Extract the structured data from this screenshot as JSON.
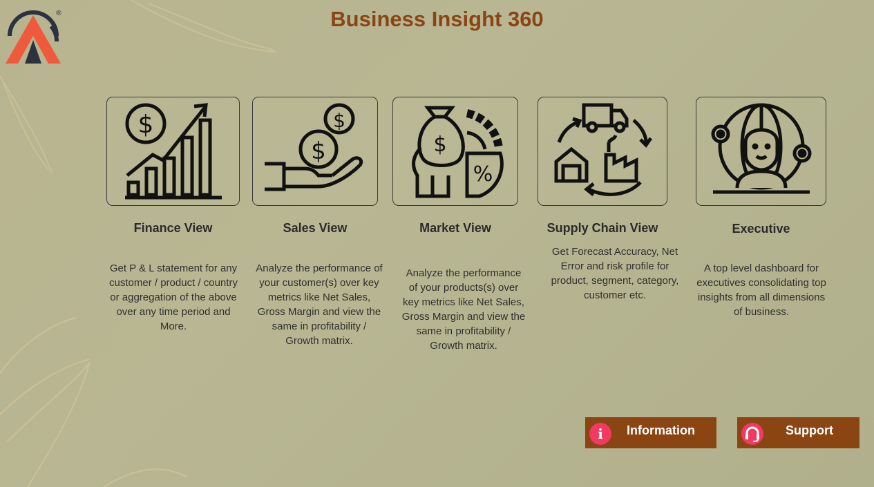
{
  "header": {
    "title": "Business Insight 360"
  },
  "logo": {
    "icon": "atliq-logo-icon",
    "mark": "®"
  },
  "cards": [
    {
      "heading": "Finance View",
      "icon": "finance-growth-icon",
      "description": "Get  P & L statement for any customer / product / country or aggregation of the above over any time period and More."
    },
    {
      "heading": "Sales View",
      "icon": "hand-coins-icon",
      "description": "Analyze the performance of your customer(s) over key metrics like Net Sales, Gross Margin and view the same in profitability / Growth matrix."
    },
    {
      "heading": "Market View",
      "icon": "market-money-bag-icon",
      "description": "Analyze the performance of your products(s) over key metrics like Net Sales, Gross Margin and view the same in profitability / Growth matrix."
    },
    {
      "heading": "Supply Chain View",
      "icon": "supply-chain-truck-icon",
      "description": "Get Forecast Accuracy, Net Error and risk profile for product, segment, category, customer etc."
    },
    {
      "heading": "Executive",
      "icon": "executive-globe-icon",
      "description": "A top level dashboard for executives consolidating top insights from all dimensions of business."
    }
  ],
  "buttons": {
    "information": {
      "label": "Information",
      "icon": "info-icon"
    },
    "support": {
      "label": "Support",
      "icon": "headset-icon"
    }
  },
  "colors": {
    "title": "#8a4515",
    "button": "#8b4513",
    "icon_badge": "#f03a5f"
  }
}
